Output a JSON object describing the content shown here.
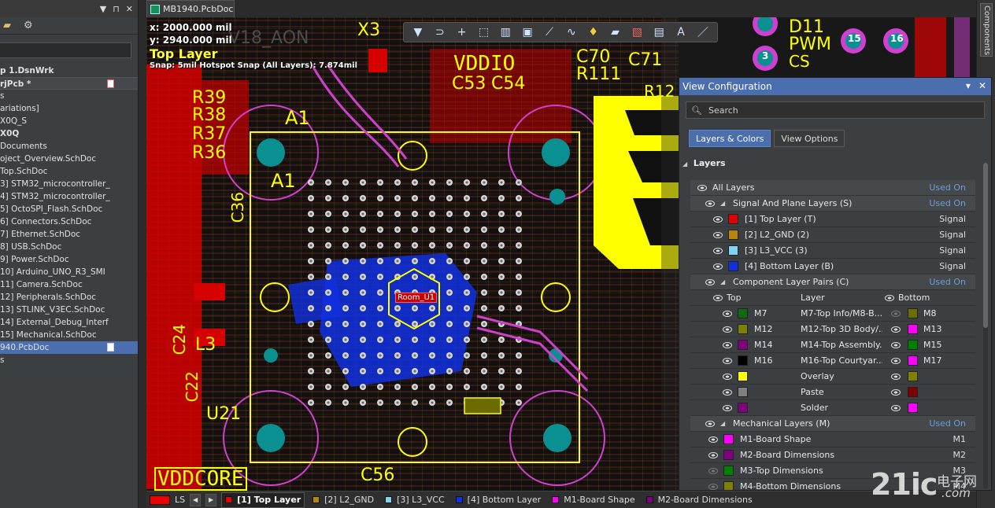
{
  "doc_tab": {
    "title": "MB1940.PcbDoc"
  },
  "project_tree": [
    {
      "label": "p 1.DsnWrk",
      "bold": true
    },
    {
      "label": "rjPcb *",
      "bold": true,
      "boxed": true,
      "badge": true
    },
    {
      "label": "s"
    },
    {
      "label": "ariations]"
    },
    {
      "label": "X0Q_S"
    },
    {
      "label": "X0Q",
      "bold": true
    },
    {
      "label": "Documents"
    },
    {
      "label": "oject_Overview.SchDoc"
    },
    {
      "label": "Top.SchDoc"
    },
    {
      "label": "3] STM32_microcontroller_"
    },
    {
      "label": "4] STM32_microcontroller_"
    },
    {
      "label": "5] OctoSPI_Flash.SchDoc"
    },
    {
      "label": "6] Connectors.SchDoc"
    },
    {
      "label": "7] Ethernet.SchDoc"
    },
    {
      "label": "8] USB.SchDoc"
    },
    {
      "label": "9] Power.SchDoc"
    },
    {
      "label": "10] Arduino_UNO_R3_SMI"
    },
    {
      "label": "11] Camera.SchDoc"
    },
    {
      "label": "12] Peripherals.SchDoc"
    },
    {
      "label": "13] STLINK_V3EC.SchDoc"
    },
    {
      "label": "14] External_Debug_Interf"
    },
    {
      "label": "15] Mechanical.SchDoc"
    },
    {
      "label": "940.PcbDoc",
      "selected": true,
      "badge": true
    },
    {
      "label": "s"
    }
  ],
  "hud": {
    "x": "x:  2000.000 mil",
    "y": "y:  2940.000 mil",
    "layer": "Top Layer",
    "snap": "Snap: 5mil Hotspot Snap (All Layers): 7.874mil"
  },
  "pcb_labels": {
    "room": "Room_U1",
    "vddio": "VDDIO",
    "vddcore": "VDDCORE",
    "a1": "A1",
    "a1_big": "A1",
    "x3": "X3",
    "c70": "C70",
    "c71": "C71",
    "r111": "R111",
    "c53": "C53",
    "c54": "C54",
    "r39": "R39",
    "r38": "R38",
    "r37": "R37",
    "r36": "R36",
    "c36": "C36",
    "l3": "L3",
    "u21": "U21",
    "c56": "C56",
    "c24": "C24",
    "c22": "C22",
    "d11": "D11",
    "pwm": "PWM",
    "cs": "CS",
    "aon": "V18_AON",
    "pad15a": "15",
    "pad16": "16",
    "pad3": "3",
    "r12": "R12"
  },
  "toolbar": {
    "icons": [
      "filter-icon",
      "route-icon",
      "plus-icon",
      "select-rect-icon",
      "chart-icon",
      "component-icon",
      "track-icon",
      "wave-icon",
      "pin-icon",
      "fill-icon",
      "layer-icon",
      "measure-icon",
      "text-icon",
      "line-icon"
    ]
  },
  "components_tab": {
    "label": "Components"
  },
  "view_config": {
    "title": "View Configuration",
    "search_placeholder": "Search",
    "tabs": [
      "Layers & Colors",
      "View Options"
    ],
    "section": "Layers",
    "rows": [
      {
        "kind": "group",
        "label": "All Layers",
        "right": "Used On",
        "indent": 0
      },
      {
        "kind": "group",
        "label": "Signal And Plane Layers (S)",
        "right": "Used On",
        "indent": 1
      },
      {
        "kind": "layer",
        "label": "[1] Top Layer (T)",
        "color": "#e00000",
        "right": "Signal"
      },
      {
        "kind": "layer",
        "label": "[2] L2_GND (2)",
        "color": "#b8860b",
        "right": "Signal"
      },
      {
        "kind": "layer",
        "label": "[3] L3_VCC (3)",
        "color": "#7fd4f0",
        "right": "Signal"
      },
      {
        "kind": "layer",
        "label": "[4] Bottom Layer (B)",
        "color": "#1030e0",
        "right": "Signal"
      },
      {
        "kind": "group",
        "label": "Component Layer Pairs (C)",
        "right": "Used On",
        "indent": 1
      },
      {
        "kind": "pairhead",
        "top": "Top",
        "layer": "Layer",
        "bottom": "Bottom"
      },
      {
        "kind": "pair",
        "tcolor": "#0f6b0f",
        "tname": "M7",
        "layer": "M7-Top Info/M8-B...",
        "bcolor": "#6b6b00",
        "bname": "M8",
        "beye": "off"
      },
      {
        "kind": "pair",
        "tcolor": "#808000",
        "tname": "M12",
        "layer": "M12-Top 3D Body/...",
        "bcolor": "#ff00ff",
        "bname": "M13",
        "beye": "on"
      },
      {
        "kind": "pair",
        "tcolor": "#800080",
        "tname": "M14",
        "layer": "M14-Top Assembly...",
        "bcolor": "#008000",
        "bname": "M15",
        "beye": "on"
      },
      {
        "kind": "pair",
        "tcolor": "#000000",
        "tname": "M16",
        "layer": "M16-Top Courtyar...",
        "bcolor": "#ff00ff",
        "bname": "M17",
        "beye": "on"
      },
      {
        "kind": "pair",
        "tcolor": "#ffff00",
        "tname": "",
        "layer": "Overlay",
        "bcolor": "#808000",
        "bname": "",
        "beye": "on"
      },
      {
        "kind": "pair",
        "tcolor": "#808080",
        "tname": "",
        "layer": "Paste",
        "bcolor": "#800000",
        "bname": "",
        "beye": "on"
      },
      {
        "kind": "pair",
        "tcolor": "#800080",
        "tname": "",
        "layer": "Solder",
        "bcolor": "#ff00ff",
        "bname": "",
        "beye": "on"
      },
      {
        "kind": "group",
        "label": "Mechanical Layers (M)",
        "right": "Used On",
        "indent": 1
      },
      {
        "kind": "mech",
        "label": "M1-Board Shape",
        "color": "#ff00ff",
        "right": "M1",
        "eye": "on"
      },
      {
        "kind": "mech",
        "label": "M2-Board Dimensions",
        "color": "#800080",
        "right": "M2",
        "eye": "on"
      },
      {
        "kind": "mech",
        "label": "M3-Top Dimensions",
        "color": "#008000",
        "right": "M3",
        "eye": "off"
      },
      {
        "kind": "mech",
        "label": "M4-Bottom Dimensions",
        "color": "#808000",
        "right": "M4",
        "eye": "off"
      }
    ]
  },
  "layer_tabs": {
    "ls": "LS",
    "items": [
      {
        "label": "[1] Top Layer",
        "color": "#e00000",
        "active": true
      },
      {
        "label": "[2] L2_GND",
        "color": "#b8860b"
      },
      {
        "label": "[3] L3_VCC",
        "color": "#7fd4f0"
      },
      {
        "label": "[4] Bottom Layer",
        "color": "#1030e0"
      },
      {
        "label": "M1-Board Shape",
        "color": "#ff00ff"
      },
      {
        "label": "M2-Board Dimensions",
        "color": "#800080"
      }
    ]
  },
  "watermark": {
    "brand": "21ic",
    "cn": "电子网",
    "url": ".com"
  },
  "colors": {
    "accent": "#4b6eaf",
    "top_layer": "#e00000",
    "overlay": "#ffff00",
    "bottom_layer": "#1030e0"
  }
}
